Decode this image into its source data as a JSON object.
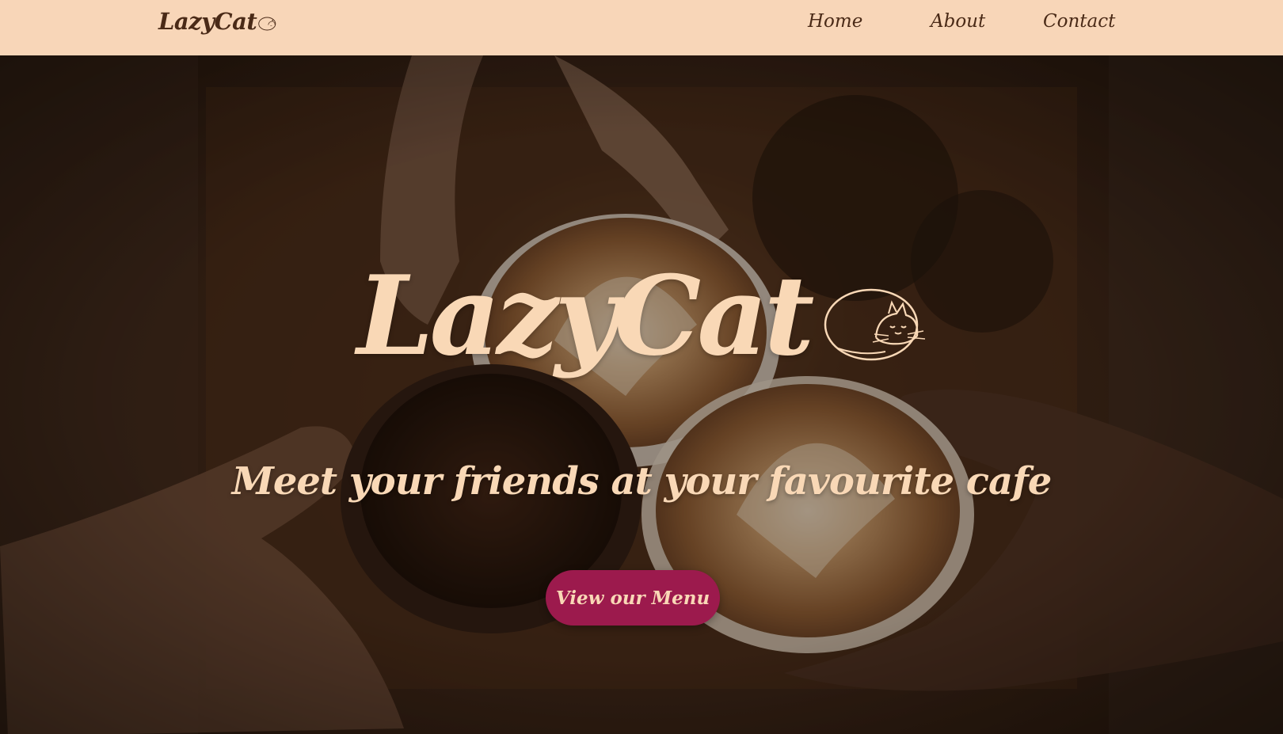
{
  "navbar": {
    "brand_text": "LazyCat",
    "brand_icon": "sleeping-cat-icon",
    "links": [
      {
        "label": "Home"
      },
      {
        "label": "About"
      },
      {
        "label": "Contact"
      }
    ]
  },
  "hero": {
    "title": "LazyCat",
    "title_icon": "sleeping-cat-icon",
    "tagline": "Meet your friends at your favourite cafe",
    "cta_label": "View our Menu",
    "background_image": "coffee-cups-toast-photo"
  },
  "colors": {
    "nav_background": "#f8d6b8",
    "nav_text": "#4a2a17",
    "hero_text": "#f9d8b6",
    "button_background": "#9c1a4d",
    "button_text": "#f9d8b6"
  }
}
